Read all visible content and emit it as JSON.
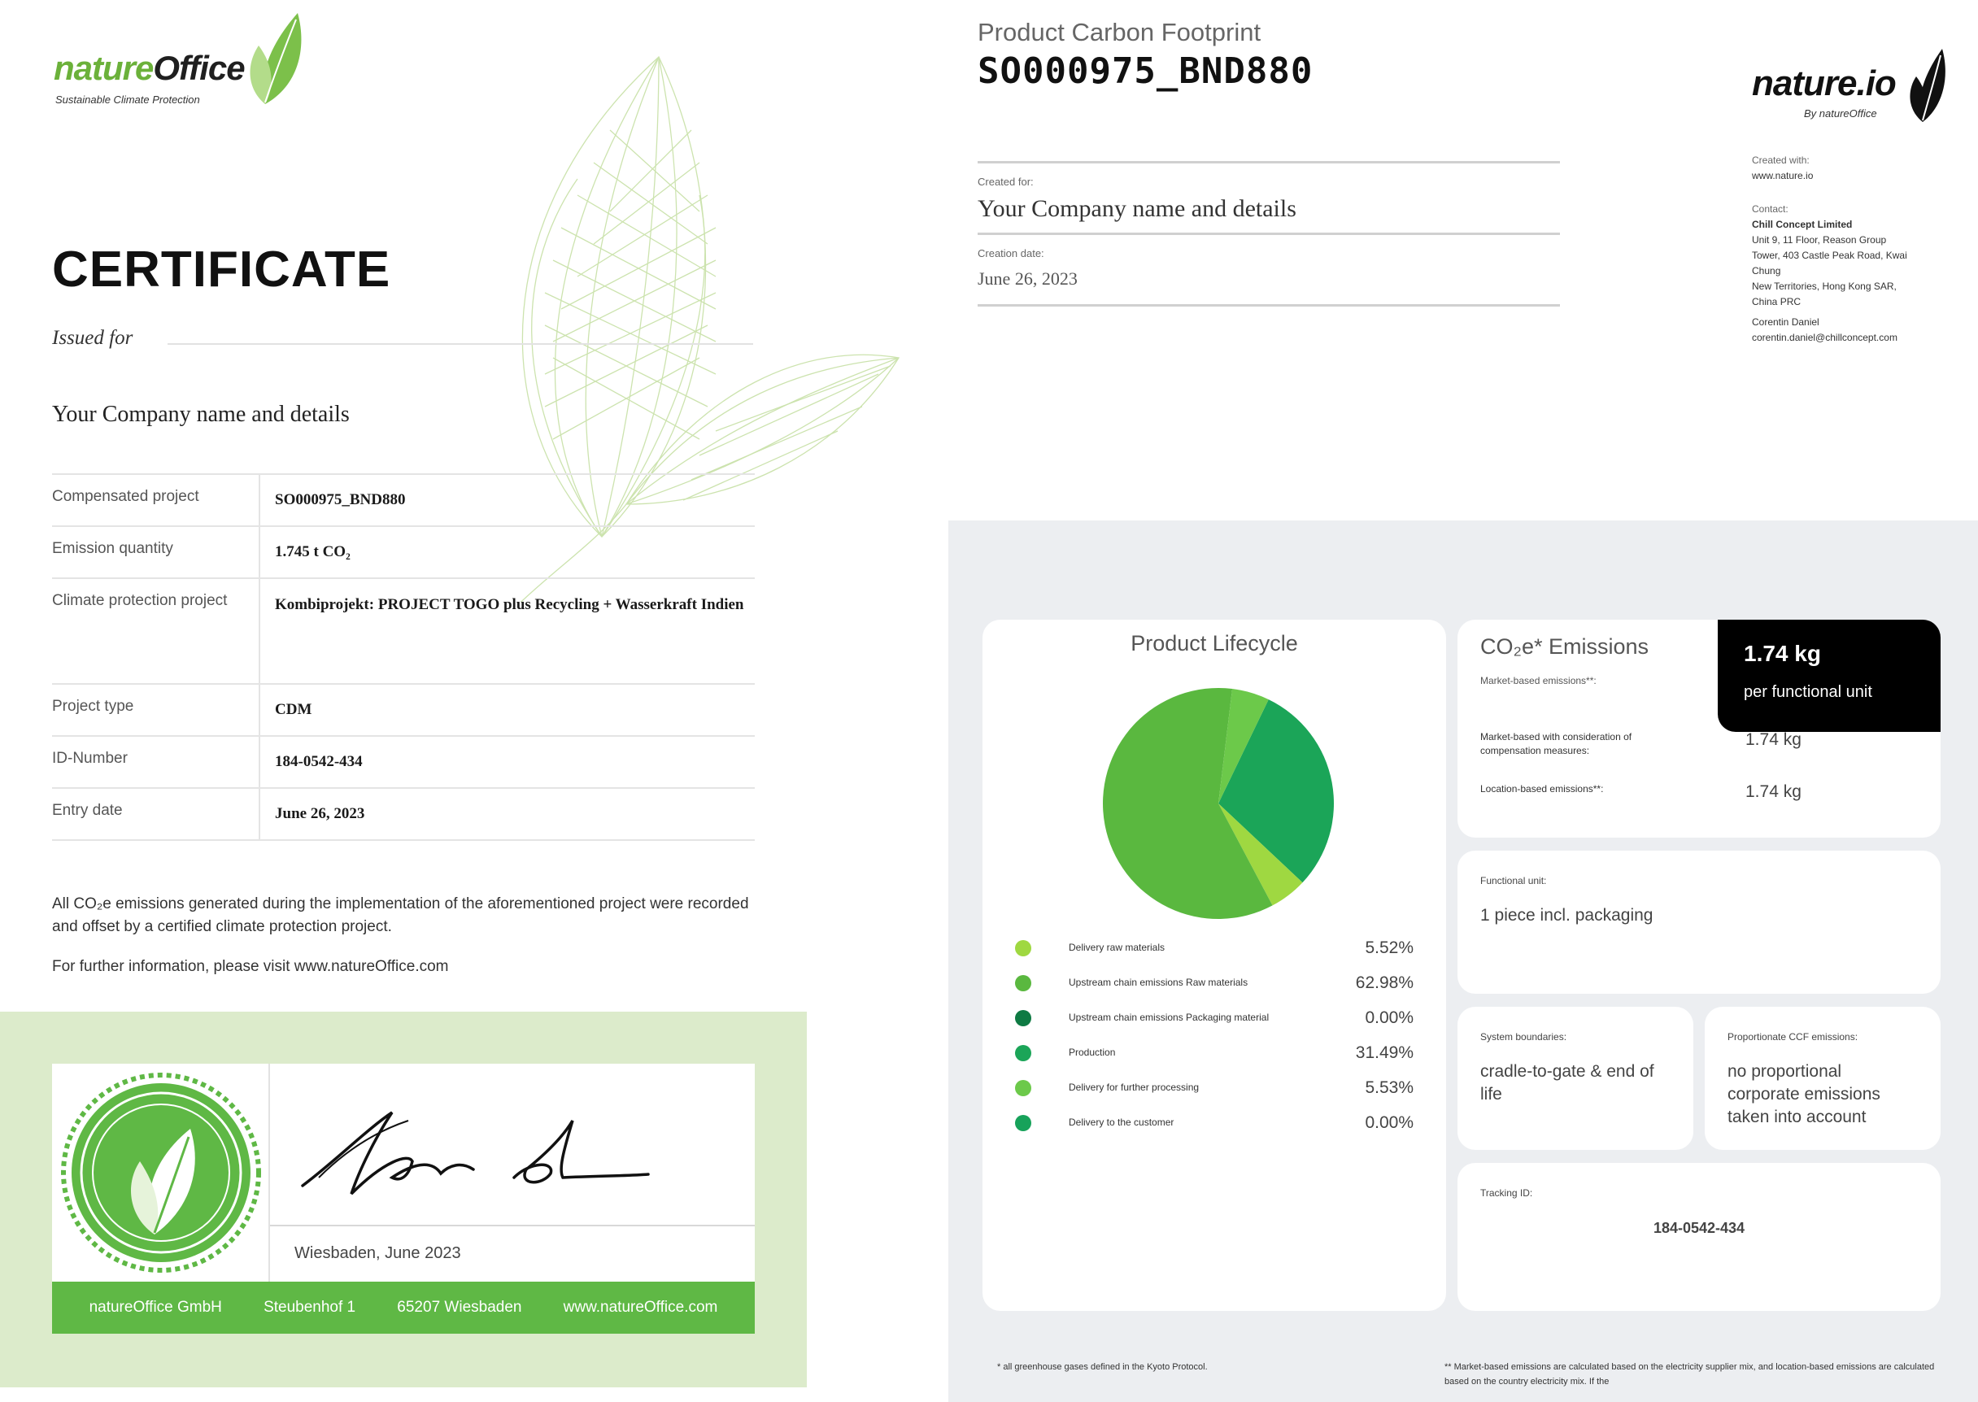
{
  "certificate": {
    "logo": {
      "word1": "nature",
      "word2": "Office",
      "tagline": "Sustainable Climate Protection"
    },
    "title": "CERTIFICATE",
    "issued_for": "Issued for",
    "company": "Your Company name and details",
    "rows": [
      {
        "label": "Compensated project",
        "value": "SO000975_BND880"
      },
      {
        "label": "Emission quantity",
        "value": "1.745 t CO₂"
      },
      {
        "label": "Climate protection project",
        "value": "Kombiprojekt: PROJECT TOGO plus Recycling + Wasserkraft Indien"
      },
      {
        "label": "Project type",
        "value": "CDM"
      },
      {
        "label": "ID-Number",
        "value": "184-0542-434"
      },
      {
        "label": "Entry date",
        "value": "June 26, 2023"
      }
    ],
    "note1": "All CO₂e emissions generated during the implementation of the aforementioned project were recorded and offset by a certified climate protection project.",
    "note2": "For further information, please visit www.natureOffice.com",
    "signature_place": "Wiesbaden, June 2023",
    "footer": [
      "natureOffice GmbH",
      "Steubenhof 1",
      "65207 Wiesbaden",
      "www.natureOffice.com"
    ]
  },
  "pcf": {
    "subtitle": "Product Carbon Footprint",
    "id": "SO000975_BND880",
    "created_for_label": "Created for:",
    "company": "Your Company name and details",
    "creation_date_label": "Creation date:",
    "creation_date": "June 26, 2023",
    "logo": {
      "word": "nature.io",
      "by": "By natureOffice"
    },
    "contact": {
      "created_with_label": "Created with:",
      "created_with": "www.nature.io",
      "contact_label": "Contact:",
      "company": "Chill Concept Limited",
      "address": [
        "Unit 9, 11 Floor, Reason Group",
        "Tower, 403 Castle Peak Road, Kwai",
        "Chung",
        "New Territories, Hong Kong SAR,",
        "China PRC"
      ],
      "person": "Corentin Daniel",
      "email": "corentin.daniel@chillconcept.com"
    },
    "lifecycle": {
      "title": "Product Lifecycle",
      "items": [
        {
          "name": "Delivery raw materials",
          "value": "5.52%",
          "pct": 5.52,
          "color": "#9fd841"
        },
        {
          "name": "Upstream chain emissions Raw materials",
          "value": "62.98%",
          "pct": 62.98,
          "color": "#5ab83f"
        },
        {
          "name": "Upstream chain emissions Packaging material",
          "value": "0.00%",
          "pct": 0,
          "color": "#0e7a43"
        },
        {
          "name": "Production",
          "value": "31.49%",
          "pct": 31.49,
          "color": "#1ba558"
        },
        {
          "name": "Delivery for further processing",
          "value": "5.53%",
          "pct": 5.53,
          "color": "#6cc94a"
        },
        {
          "name": "Delivery to the customer",
          "value": "0.00%",
          "pct": 0,
          "color": "#17a25a"
        }
      ]
    },
    "emissions": {
      "title": "CO₂e* Emissions",
      "market_label": "Market-based emissions**:",
      "total": "1.74 kg",
      "total_unit": "per functional unit",
      "rows": [
        {
          "label": "Market-based with consideration of compensation measures:",
          "value": "1.74 kg"
        },
        {
          "label": "Location-based emissions**:",
          "value": "1.74 kg"
        }
      ]
    },
    "functional_unit": {
      "label": "Functional unit:",
      "value": "1 piece incl. packaging"
    },
    "system_boundaries": {
      "label": "System boundaries:",
      "value": "cradle-to-gate & end of life"
    },
    "proportionate": {
      "label": "Proportionate CCF emissions:",
      "value": "no proportional corporate emissions taken into account"
    },
    "tracking": {
      "label": "Tracking ID:",
      "value": "184-0542-434"
    },
    "footnote1": "* all greenhouse gases defined in the Kyoto Protocol.",
    "footnote2": "** Market-based emissions are calculated based on the electricity supplier mix, and location-based emissions are calculated based on the country electricity mix. If the"
  }
}
